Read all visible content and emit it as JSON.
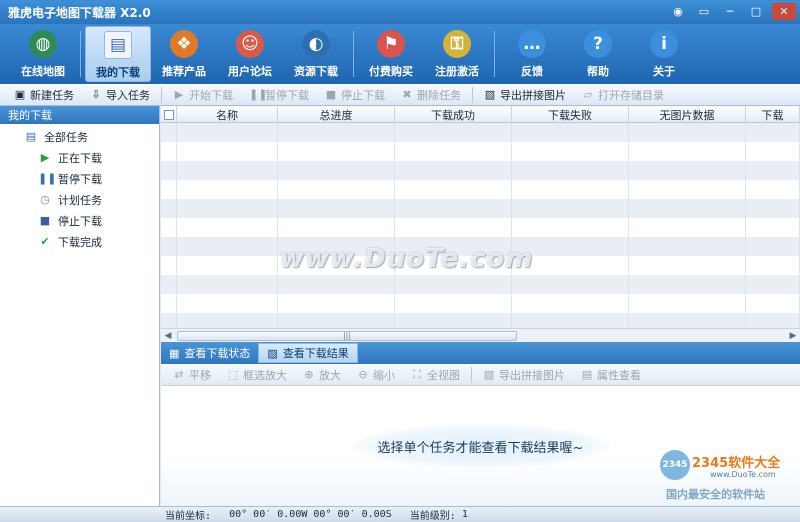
{
  "window": {
    "title": "雅虎电子地图下载器 X2.0",
    "controls": [
      "◉",
      "▭",
      "─",
      "□",
      "✕"
    ]
  },
  "main_toolbar": [
    {
      "label": "在线地图",
      "icon": "globe-icon",
      "color": "#2e8b57",
      "glyph": "◍"
    },
    {
      "label": "我的下载",
      "icon": "download-list-icon",
      "color": "#f1f5fb",
      "glyph": "▤",
      "active": true
    },
    {
      "label": "推荐产品",
      "icon": "cubes-icon",
      "color": "#e07a2a",
      "glyph": "❖"
    },
    {
      "label": "用户论坛",
      "icon": "users-icon",
      "color": "#d95a4a",
      "glyph": "☺"
    },
    {
      "label": "资源下载",
      "icon": "disc-icon",
      "color": "#2d6fb3",
      "glyph": "◐"
    },
    {
      "label": "付费购买",
      "icon": "cart-icon",
      "color": "#d9534f",
      "glyph": "⚑"
    },
    {
      "label": "注册激活",
      "icon": "lock-icon",
      "color": "#d7b23a",
      "glyph": "⚿"
    },
    {
      "label": "反馈",
      "icon": "chat-icon",
      "color": "#3b8fdc",
      "glyph": "…"
    },
    {
      "label": "帮助",
      "icon": "help-icon",
      "color": "#3b8fdc",
      "glyph": "?"
    },
    {
      "label": "关于",
      "icon": "info-icon",
      "color": "#3b8fdc",
      "glyph": "i"
    }
  ],
  "task_toolbar": [
    {
      "label": "新建任务",
      "icon": "new-task-icon",
      "glyph": "▣",
      "disabled": false
    },
    {
      "label": "导入任务",
      "icon": "import-icon",
      "glyph": "⇩",
      "disabled": false
    },
    {
      "label": "开始下载",
      "icon": "play-icon",
      "glyph": "▶",
      "disabled": true
    },
    {
      "label": "暂停下载",
      "icon": "pause-icon",
      "glyph": "❚❚",
      "disabled": true
    },
    {
      "label": "停止下载",
      "icon": "stop-icon",
      "glyph": "■",
      "disabled": true
    },
    {
      "label": "删除任务",
      "icon": "delete-icon",
      "glyph": "✖",
      "disabled": true
    },
    {
      "label": "导出拼接图片",
      "icon": "export-image-icon",
      "glyph": "▧",
      "disabled": false
    },
    {
      "label": "打开存储目录",
      "icon": "folder-icon",
      "glyph": "▱",
      "disabled": true
    }
  ],
  "left_panel": {
    "header": "我的下载",
    "root": {
      "label": "全部任务",
      "icon": "list-icon",
      "glyph": "▤"
    },
    "children": [
      {
        "label": "正在下载",
        "icon": "play-icon",
        "glyph": "▶",
        "color": "#2e9b3e"
      },
      {
        "label": "暂停下载",
        "icon": "pause-icon",
        "glyph": "❚❚",
        "color": "#3b6fb0"
      },
      {
        "label": "计划任务",
        "icon": "clock-icon",
        "glyph": "◷",
        "color": "#7a8796"
      },
      {
        "label": "停止下载",
        "icon": "stop-icon",
        "glyph": "■",
        "color": "#3b5fa0"
      },
      {
        "label": "下载完成",
        "icon": "check-icon",
        "glyph": "✔",
        "color": "#2e9b3e"
      }
    ]
  },
  "grid": {
    "columns": [
      "",
      "名称",
      "总进度",
      "下载成功",
      "下载失败",
      "无图片数据",
      "下载"
    ],
    "row_count": 11
  },
  "lower_tabs": [
    {
      "label": "查看下载状态",
      "icon": "grid-icon",
      "glyph": "▦",
      "active": false
    },
    {
      "label": "查看下载结果",
      "icon": "map-result-icon",
      "glyph": "▨",
      "active": true
    }
  ],
  "result_toolbar": [
    {
      "label": "平移",
      "icon": "pan-icon",
      "glyph": "⇄"
    },
    {
      "label": "框选放大",
      "icon": "box-zoom-icon",
      "glyph": "⬚"
    },
    {
      "label": "放大",
      "icon": "zoom-in-icon",
      "glyph": "⊕"
    },
    {
      "label": "缩小",
      "icon": "zoom-out-icon",
      "glyph": "⊖"
    },
    {
      "label": "全视图",
      "icon": "full-view-icon",
      "glyph": "⛶"
    },
    {
      "label": "导出拼接图片",
      "icon": "export-image-icon",
      "glyph": "▧"
    },
    {
      "label": "属性查看",
      "icon": "properties-icon",
      "glyph": "▤"
    }
  ],
  "result_hint": "选择单个任务才能查看下载结果喔~",
  "watermark": "www.DuoTe.com",
  "corner_logo": {
    "badge": "2345",
    "brand": "2345软件大全",
    "url": "www.DuoTe.com",
    "slogan": "国内最安全的软件站"
  },
  "statusbar": {
    "coord_label": "当前坐标:",
    "lon": "00° 00′ 0.00W",
    "lat": "00° 00′ 0.00S",
    "level_label": "当前级别:",
    "level": "1"
  }
}
